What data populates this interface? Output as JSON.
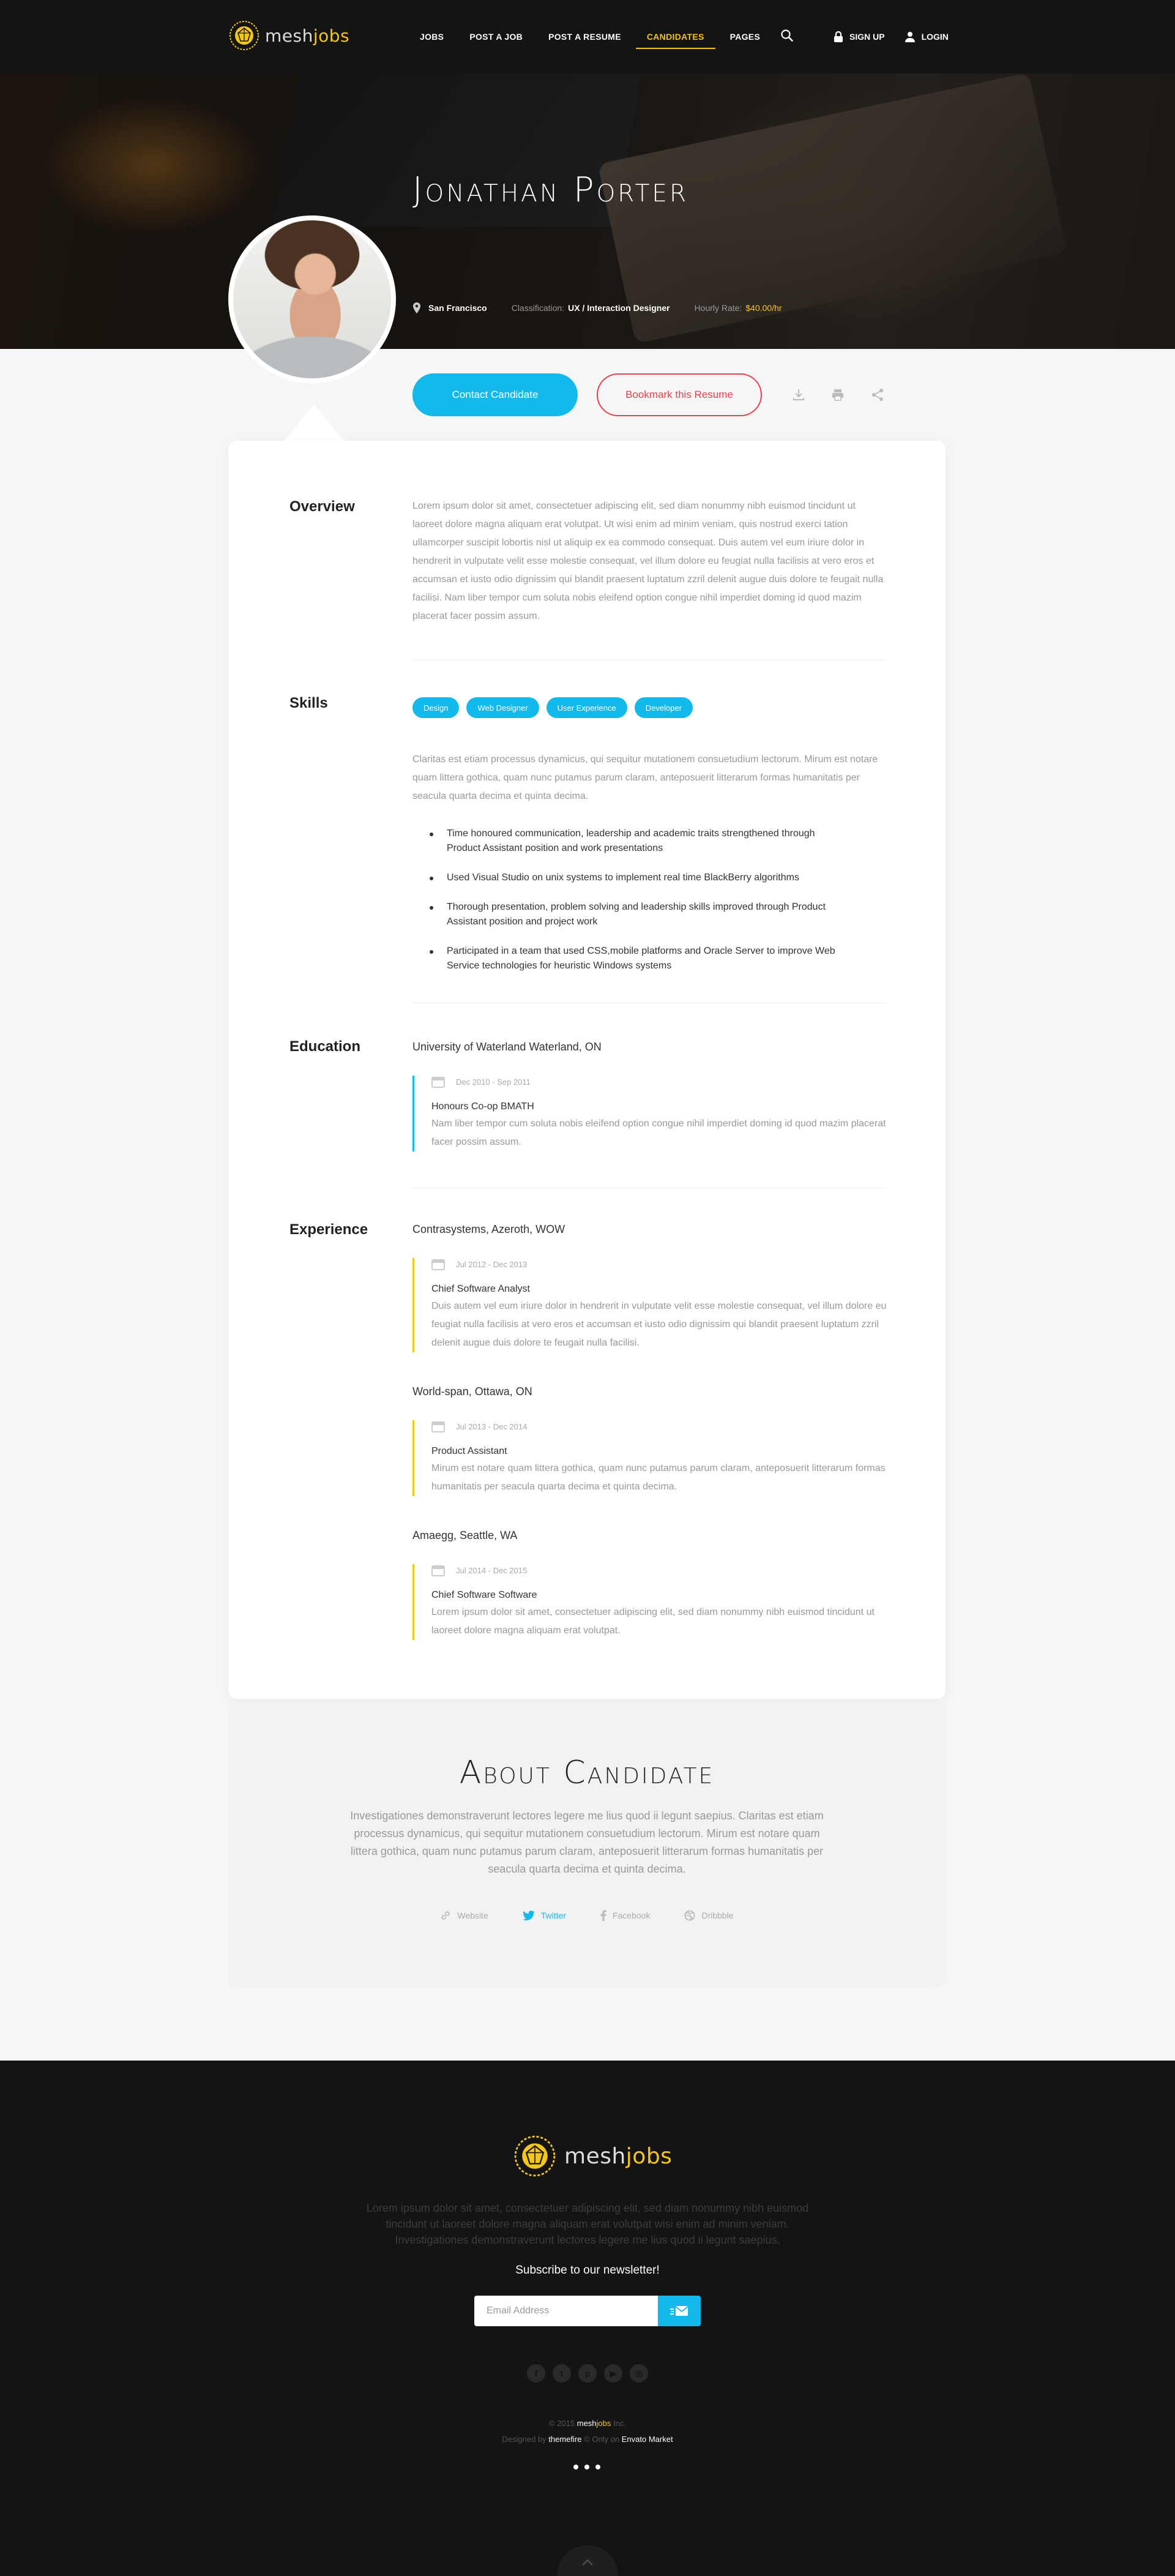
{
  "brand": {
    "name_part1": "mesh",
    "name_part2": "jobs",
    "accent": "#f5c518",
    "primary": "#14b9eb",
    "danger": "#e8404c"
  },
  "nav": {
    "items": [
      {
        "label": "JOBS"
      },
      {
        "label": "POST A JOB"
      },
      {
        "label": "POST A RESUME"
      },
      {
        "label": "CANDIDATES",
        "active": true
      },
      {
        "label": "PAGES"
      }
    ],
    "search_icon": "search-icon",
    "signup_label": "SIGN UP",
    "login_label": "LOGIN"
  },
  "hero": {
    "name": "Jonathan Porter",
    "location": "San Francisco",
    "classification_key": "Classification:",
    "classification_value": "UX / Interaction Designer",
    "rate_key": "Hourly Rate:",
    "rate_value": "$40.00/hr"
  },
  "actions": {
    "contact_label": "Contact Candidate",
    "bookmark_label": "Bookmark this Resume",
    "icons": [
      "download-icon",
      "print-icon",
      "share-icon"
    ]
  },
  "overview": {
    "title": "Overview",
    "text": "Lorem ipsum dolor sit amet, consectetuer adipiscing elit, sed diam nonummy nibh euismod tincidunt ut laoreet dolore magna aliquam erat volutpat. Ut wisi enim ad minim veniam, quis nostrud exerci tation ullamcorper suscipit lobortis nisl ut aliquip ex ea commodo consequat. Duis autem vel eum iriure dolor in hendrerit in vulputate velit esse molestie consequat, vel illum dolore eu feugiat nulla facilisis at vero eros et accumsan et iusto odio dignissim qui blandit praesent luptatum zzril delenit augue duis dolore te feugait nulla facilisi. Nam liber tempor cum soluta nobis eleifend option congue nihil imperdiet doming id quod mazim placerat facer possim assum."
  },
  "skills": {
    "title": "Skills",
    "chips": [
      "Design",
      "Web Designer",
      "User Experience",
      "Developer"
    ],
    "text": "Claritas est etiam processus dynamicus, qui sequitur mutationem consuetudium lectorum. Mirum est notare quam littera gothica, quam nunc putamus parum claram, anteposuerit litterarum formas humanitatis per seacula quarta decima et quinta decima.",
    "bullets": [
      "Time honoured communication, leadership and academic traits strengthened through Product Assistant position and work presentations",
      "Used Visual Studio on unix systems to implement real time BlackBerry algorithms",
      "Thorough presentation, problem solving and leadership skills improved through Product Assistant position and project work",
      "Participated in a team that used CSS,mobile platforms and Oracle Server to improve Web Service technologies for heuristic Windows systems"
    ]
  },
  "education": {
    "title": "Education",
    "items": [
      {
        "org": "University of Waterland Waterland, ON",
        "dates": "Dec 2010 - Sep 2011",
        "role": "Honours Co-op BMATH",
        "desc": "Nam liber tempor cum soluta nobis eleifend option congue nihil imperdiet doming id quod mazim placerat facer possim assum."
      }
    ]
  },
  "experience": {
    "title": "Experience",
    "items": [
      {
        "org": "Contrasystems, Azeroth, WOW",
        "dates": "Jul 2012 - Dec 2013",
        "role": "Chief Software Analyst",
        "desc": "Duis autem vel eum iriure dolor in hendrerit in vulputate velit esse molestie consequat, vel illum dolore eu feugiat nulla facilisis at vero eros et accumsan et iusto odio dignissim qui blandit praesent luptatum zzril delenit augue duis dolore te feugait nulla facilisi."
      },
      {
        "org": "World-span, Ottawa, ON",
        "dates": "Jul 2013 - Dec 2014",
        "role": "Product Assistant",
        "desc": "Mirum est notare quam littera gothica, quam nunc putamus parum claram, anteposuerit litterarum formas humanitatis per seacula quarta decima et quinta decima."
      },
      {
        "org": "Amaegg, Seattle, WA",
        "dates": "Jul 2014 - Dec 2015",
        "role": "Chief Software Software",
        "desc": "Lorem ipsum dolor sit amet, consectetuer adipiscing elit, sed diam nonummy nibh euismod tincidunt ut laoreet dolore magna aliquam erat volutpat."
      }
    ]
  },
  "about": {
    "title": "About Candidate",
    "text": "Investigationes demonstraverunt lectores legere me lius quod ii legunt saepius. Claritas est etiam processus dynamicus, qui sequitur mutationem consuetudium lectorum. Mirum est notare quam littera gothica, quam nunc putamus parum claram, anteposuerit litterarum formas humanitatis per seacula quarta decima et quinta decima.",
    "links": [
      {
        "label": "Website",
        "icon": "link-icon"
      },
      {
        "label": "Twitter",
        "icon": "twitter-icon",
        "active": true
      },
      {
        "label": "Facebook",
        "icon": "facebook-icon"
      },
      {
        "label": "Dribbble",
        "icon": "dribbble-icon"
      }
    ]
  },
  "footer": {
    "text": "Lorem ipsum dolor sit amet, consectetuer adipiscing elit, sed diam nonummy nibh euismod tincidunt ut laoreet dolore magna aliquam erat volutpat wisi enim ad minim veniam. Investigationes demonstraverunt lectores legere me lius quod ii legunt saepius.",
    "subscribe_title": "Subscribe to our newsletter!",
    "email_placeholder": "Email Address",
    "social_icons": [
      "facebook-icon",
      "twitter-icon",
      "pinterest-icon",
      "youtube-icon",
      "dribbble-icon"
    ],
    "copy_prefix": "© 2015",
    "copy_brand1": "mesh",
    "copy_brand2": "jobs",
    "copy_suffix": "Inc.",
    "designed_by": "Designed by",
    "designer": "themefire",
    "only_on": "© Only on",
    "market": "Envato Market"
  }
}
